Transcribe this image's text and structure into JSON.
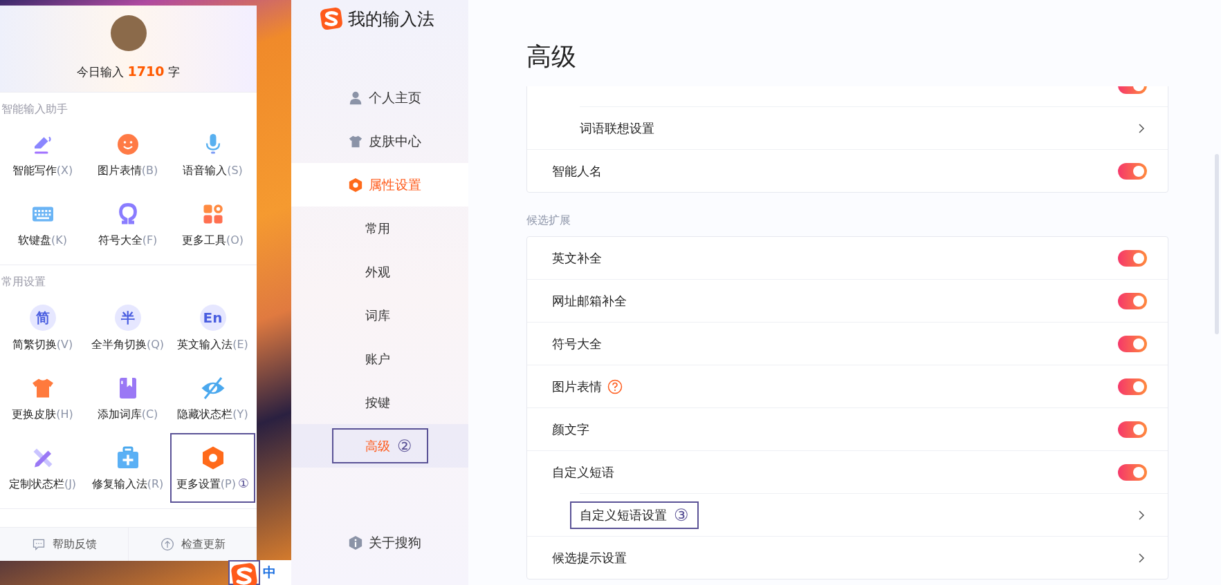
{
  "popup": {
    "today_prefix": "今日输入",
    "today_count": "1710",
    "today_suffix": "字",
    "sections": [
      {
        "title": "智能输入助手",
        "tools": [
          {
            "label": "智能写作",
            "key": "(X)"
          },
          {
            "label": "图片表情",
            "key": "(B)"
          },
          {
            "label": "语音输入",
            "key": "(S)"
          },
          {
            "label": "软键盘",
            "key": "(K)"
          },
          {
            "label": "符号大全",
            "key": "(F)"
          },
          {
            "label": "更多工具",
            "key": "(O)"
          }
        ]
      },
      {
        "title": "常用设置",
        "tools": [
          {
            "glyph": "简",
            "label": "简繁切换",
            "key": "(V)"
          },
          {
            "glyph": "半",
            "label": "全半角切换",
            "key": "(Q)"
          },
          {
            "glyph": "En",
            "label": "英文输入法",
            "key": "(E)"
          },
          {
            "label": "更换皮肤",
            "key": "(H)"
          },
          {
            "label": "添加词库",
            "key": "(C)"
          },
          {
            "label": "隐藏状态栏",
            "key": "(Y)"
          },
          {
            "label": "定制状态栏",
            "key": "(J)"
          },
          {
            "label": "修复输入法",
            "key": "(R)"
          },
          {
            "label": "更多设置",
            "key": "(P)",
            "marker": "①"
          }
        ]
      }
    ],
    "footer": [
      {
        "label": "帮助反馈"
      },
      {
        "label": "检查更新"
      }
    ]
  },
  "status_bar": {
    "mode": "中",
    "boxed": true
  },
  "sidebar": {
    "app_title": "我的输入法",
    "items": [
      {
        "label": "个人主页",
        "selected": false
      },
      {
        "label": "皮肤中心",
        "selected": false
      },
      {
        "label": "属性设置",
        "selected": true,
        "children": [
          {
            "label": "常用",
            "selected": false
          },
          {
            "label": "外观",
            "selected": false
          },
          {
            "label": "词库",
            "selected": false
          },
          {
            "label": "账户",
            "selected": false
          },
          {
            "label": "按键",
            "selected": false
          },
          {
            "label": "高级",
            "selected": true,
            "marker": "②"
          }
        ]
      },
      {
        "label": "关于搜狗",
        "selected": false
      }
    ]
  },
  "main": {
    "title": "高级",
    "groups": [
      {
        "rows": [
          {
            "kind": "toggle",
            "on": true,
            "children": [
              {
                "kind": "link",
                "label": "词语联想设置"
              }
            ]
          },
          {
            "kind": "toggle",
            "label": "智能人名",
            "on": true
          }
        ]
      },
      {
        "title": "候选扩展",
        "rows": [
          {
            "kind": "toggle",
            "label": "英文补全",
            "on": true
          },
          {
            "kind": "toggle",
            "label": "网址邮箱补全",
            "on": true
          },
          {
            "kind": "toggle",
            "label": "符号大全",
            "on": true
          },
          {
            "kind": "toggle",
            "label": "图片表情",
            "on": true,
            "help": true
          },
          {
            "kind": "toggle",
            "label": "颜文字",
            "on": true
          },
          {
            "kind": "toggle",
            "label": "自定义短语",
            "on": true,
            "children": [
              {
                "kind": "link",
                "label": "自定义短语设置",
                "marker": "③"
              }
            ]
          },
          {
            "kind": "link",
            "label": "候选提示设置"
          }
        ]
      }
    ]
  }
}
